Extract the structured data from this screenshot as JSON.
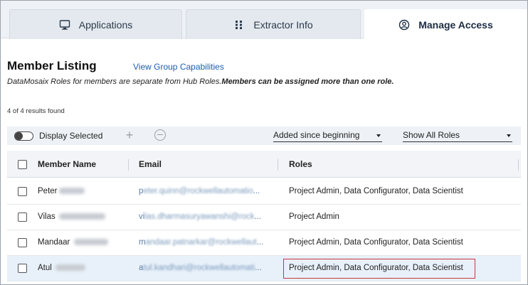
{
  "tabs": [
    {
      "label": "Applications",
      "icon": "monitor-icon"
    },
    {
      "label": "Extractor Info",
      "icon": "grid-icon"
    },
    {
      "label": "Manage Access",
      "icon": "user-circle-icon"
    }
  ],
  "header": {
    "title": "Member Listing",
    "link": "View Group Capabilities",
    "subtitle_normal": "DataMosaix Roles for members are separate from Hub Roles.",
    "subtitle_bold": "Members can be assigned more than one role.",
    "results": "4 of 4 results found"
  },
  "toolbar": {
    "toggle_label": "Display Selected",
    "filter_date": "Added since beginning",
    "filter_roles": "Show All Roles"
  },
  "table": {
    "columns": [
      "Member Name",
      "Email",
      "Roles"
    ],
    "rows": [
      {
        "name": "Peter",
        "email_visible": "p",
        "email_blurred": "eter.quinn@rockwellautomatio",
        "email_suffix": "...",
        "roles": "Project Admin, Data Configurator, Data Scientist"
      },
      {
        "name": "Vilas",
        "email_visible": "vi",
        "email_blurred": "las.dharmasuryawanshi@rock",
        "email_suffix": "...",
        "roles": "Project Admin"
      },
      {
        "name": "Mandaar",
        "email_visible": "m",
        "email_blurred": "andaar.patnarkar@rockwellaut",
        "email_suffix": "...",
        "roles": "Project Admin, Data Configurator, Data Scientist"
      },
      {
        "name": "Atul",
        "email_visible": "a",
        "email_blurred": "tul.kandhari@rockwellautomati",
        "email_suffix": "...",
        "roles": "Project Admin, Data Configurator, Data Scientist"
      }
    ]
  },
  "colors": {
    "accent": "#1a5fb4",
    "highlight_border": "#c9353c",
    "selected_row": "#e8f1fa"
  }
}
